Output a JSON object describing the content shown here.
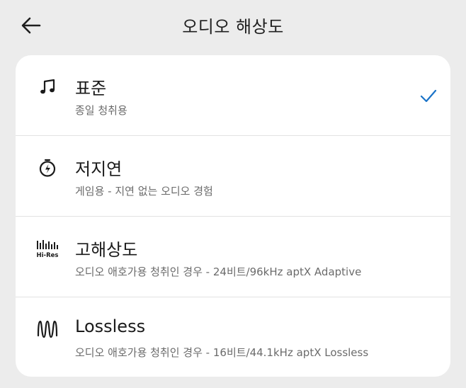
{
  "header": {
    "back_icon": "arrow-left-icon",
    "title": "오디오 해상도"
  },
  "options": [
    {
      "title": "표준",
      "subtitle": "종일 청취용",
      "icon": "music-note-icon",
      "selected": true
    },
    {
      "title": "저지연",
      "subtitle": "게임용 - 지연 없는 오디오 경험",
      "icon": "stopwatch-bolt-icon",
      "selected": false
    },
    {
      "title": "고해상도",
      "subtitle": "오디오 애호가용 청취인 경우 - 24비트/96kHz aptX Adaptive",
      "icon": "hi-res-icon",
      "icon_text": "Hi-Res",
      "selected": false
    },
    {
      "title": "Lossless",
      "subtitle": "오디오 애호가용 청취인 경우 - 16비트/44.1kHz aptX Lossless",
      "icon": "lossless-wave-icon",
      "selected": false
    }
  ],
  "colors": {
    "background": "#ececec",
    "card": "#ffffff",
    "accent_check": "#1a73c8",
    "subtitle": "#6b6b6b"
  }
}
